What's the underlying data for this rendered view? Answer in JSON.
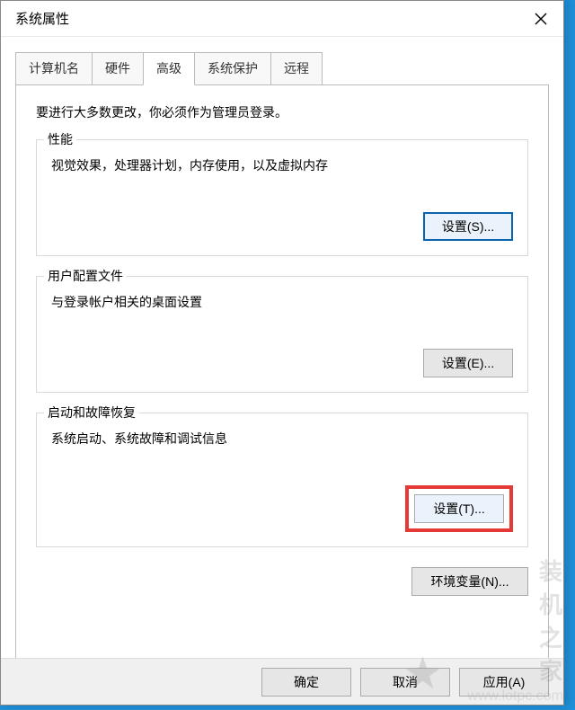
{
  "window": {
    "title": "系统属性"
  },
  "tabs": {
    "computer_name": "计算机名",
    "hardware": "硬件",
    "advanced": "高级",
    "system_protection": "系统保护",
    "remote": "远程"
  },
  "content": {
    "intro": "要进行大多数更改，你必须作为管理员登录。",
    "performance": {
      "title": "性能",
      "desc": "视觉效果，处理器计划，内存使用，以及虚拟内存",
      "button": "设置(S)..."
    },
    "user_profiles": {
      "title": "用户配置文件",
      "desc": "与登录帐户相关的桌面设置",
      "button": "设置(E)..."
    },
    "startup_recovery": {
      "title": "启动和故障恢复",
      "desc": "系统启动、系统故障和调试信息",
      "button": "设置(T)..."
    },
    "env_vars_button": "环境变量(N)..."
  },
  "buttons": {
    "ok": "确定",
    "cancel": "取消",
    "apply": "应用(A)"
  },
  "watermark": {
    "text": "装机之家",
    "url": "www.lotpc.com"
  }
}
